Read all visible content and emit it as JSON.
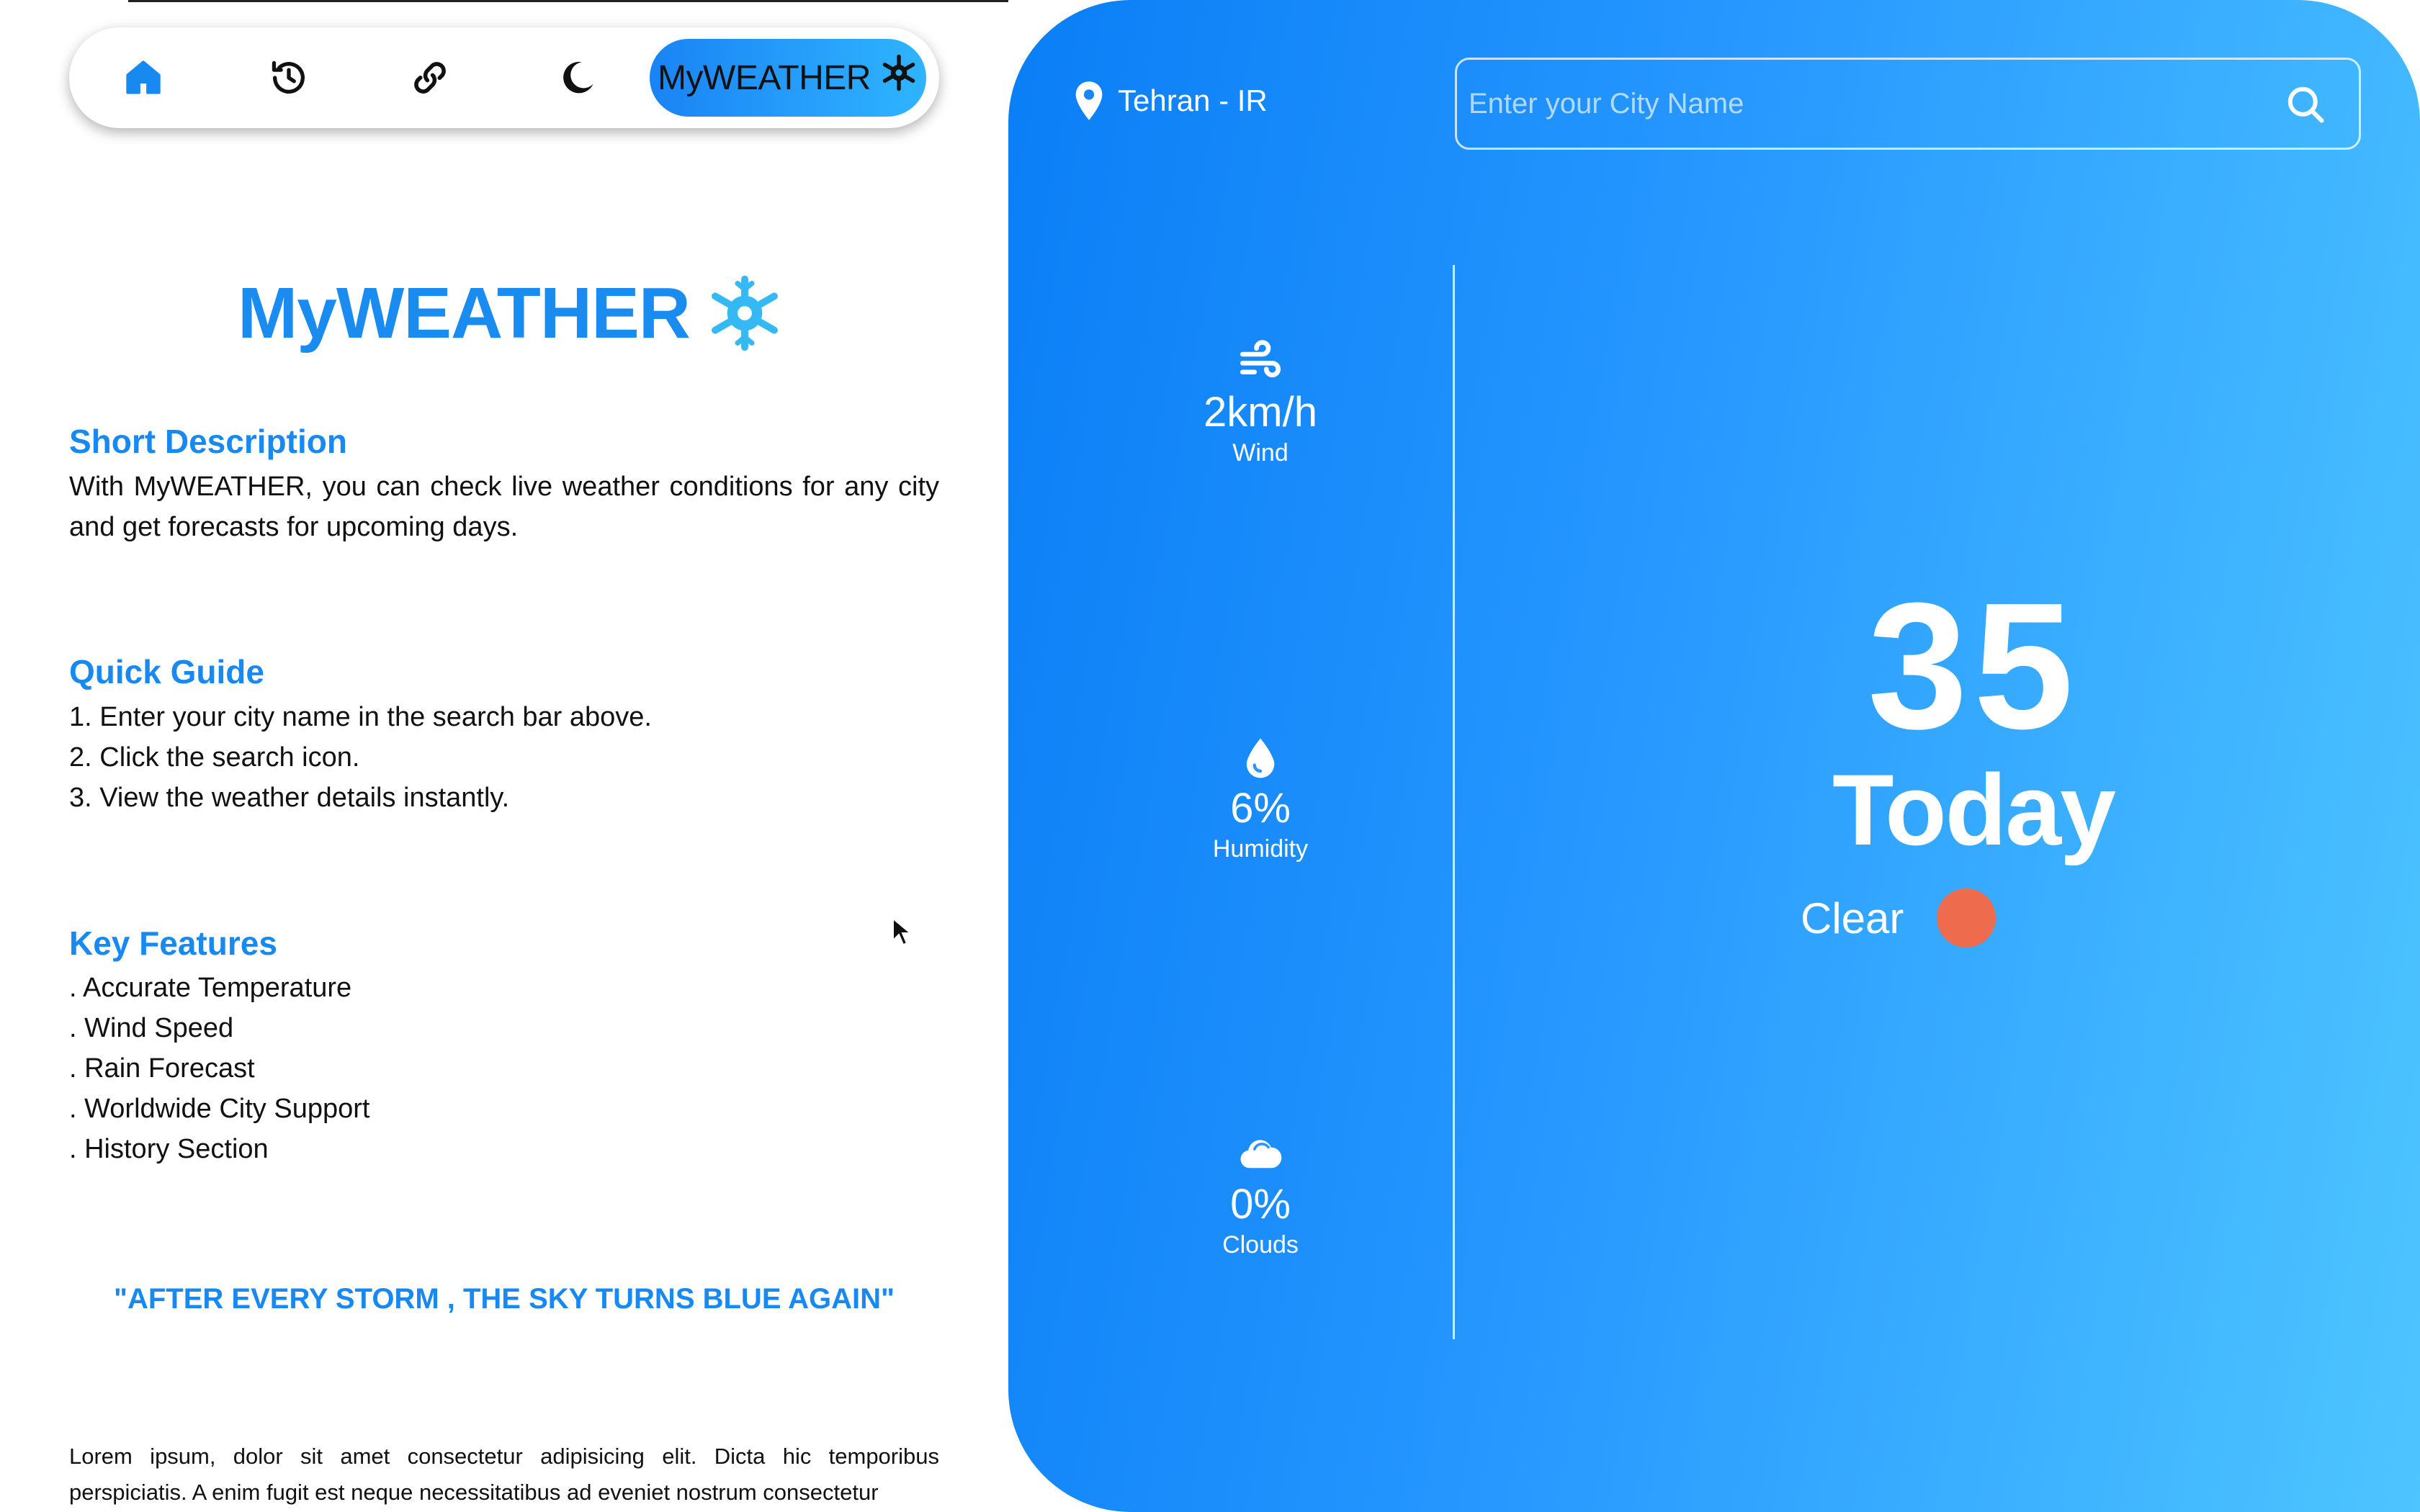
{
  "navbar": {
    "items": [
      {
        "name": "home",
        "icon": "home-icon",
        "active": true
      },
      {
        "name": "history",
        "icon": "history-icon"
      },
      {
        "name": "links",
        "icon": "link-icon"
      },
      {
        "name": "dark-mode",
        "icon": "moon-icon"
      }
    ],
    "brand_label": "MyWEATHER",
    "brand_icon": "snowflake-icon"
  },
  "intro": {
    "logo_text": "MyWEATHER",
    "logo_icon": "snowflake-icon",
    "short_description": {
      "title": "Short Description",
      "text": "With MyWEATHER, you can check live weather conditions for any city and get forecasts for upcoming days."
    },
    "quick_guide": {
      "title": "Quick Guide",
      "steps": [
        "1. Enter your city name in the search bar above.",
        "2. Click the search icon.",
        "3. View the weather details instantly."
      ]
    },
    "key_features": {
      "title": "Key Features",
      "items": [
        ". Accurate Temperature",
        ". Wind Speed",
        ". Rain Forecast",
        ". Worldwide City Support",
        ". History Section"
      ]
    },
    "quote": "\"AFTER EVERY STORM , THE SKY TURNS BLUE AGAIN\"",
    "lorem": "Lorem ipsum, dolor sit amet consectetur adipisicing elit. Dicta hic temporibus perspiciatis. A enim fugit est neque necessitatibus ad eveniet nostrum consectetur"
  },
  "weather": {
    "location": "Tehran - IR",
    "search": {
      "placeholder": "Enter your City Name",
      "value": ""
    },
    "stats": [
      {
        "icon": "wind-icon",
        "value": "2km/h",
        "label": "Wind"
      },
      {
        "icon": "droplet-icon",
        "value": "6%",
        "label": "Humidity"
      },
      {
        "icon": "cloud-icon",
        "value": "0%",
        "label": "Clouds"
      }
    ],
    "temperature": "35",
    "day": "Today",
    "condition": "Clear",
    "condition_icon": "sun-icon"
  },
  "colors": {
    "accent": "#1789f0",
    "panel_start": "#0a7ef6",
    "panel_end": "#4ec5ff",
    "sun": "#ee6b4d",
    "ink": "#111111"
  }
}
